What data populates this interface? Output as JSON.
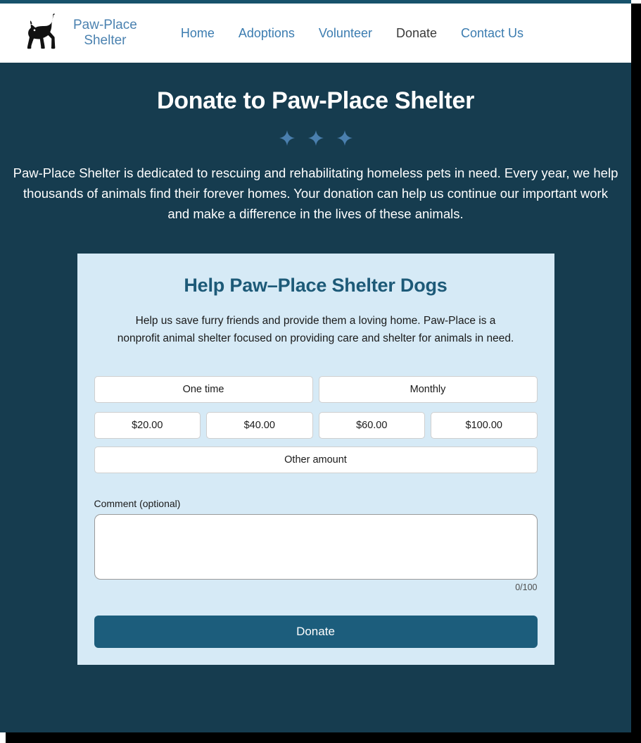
{
  "theme": {
    "page_bg": "#163c4f",
    "navbar_bg": "#ffffff",
    "brand_color": "#4b82b0",
    "nav_link_color": "#3b7cb0",
    "nav_link_active_color": "#3a3a3a",
    "card_bg": "#d6eaf6",
    "card_title_color": "#1d5a78",
    "donate_button_bg": "#1c5d7c",
    "sparkle_color": "#4a7fae",
    "option_button_bg": "#ffffff"
  },
  "navbar": {
    "logo_icon": "cat-silhouette-icon",
    "brand_name": "Paw-Place\nShelter",
    "links": [
      {
        "label": "Home",
        "active": false
      },
      {
        "label": "Adoptions",
        "active": false
      },
      {
        "label": "Volunteer",
        "active": false
      },
      {
        "label": "Donate",
        "active": true
      },
      {
        "label": "Contact Us",
        "active": false
      }
    ]
  },
  "hero": {
    "title": "Donate to Paw-Place Shelter",
    "decoration_icon": "sparkle-icon",
    "decoration_count": 3,
    "body": "Paw-Place Shelter is dedicated to rescuing and rehabilitating homeless pets in need. Every year, we help thousands of animals find their forever homes. Your donation can help us continue our important work and make a difference in the lives of these animals."
  },
  "donation_card": {
    "title": "Help Paw–Place Shelter Dogs",
    "description": "Help us save furry friends and provide them a loving home. Paw-Place is a nonprofit animal shelter focused on providing care and shelter for animals in need.",
    "frequency_options": [
      {
        "label": "One time"
      },
      {
        "label": "Monthly"
      }
    ],
    "amount_options": [
      {
        "label": "$20.00"
      },
      {
        "label": "$40.00"
      },
      {
        "label": "$60.00"
      },
      {
        "label": "$100.00"
      }
    ],
    "other_amount": {
      "label": "Other amount"
    },
    "comment": {
      "label": "Comment (optional)",
      "value": "",
      "placeholder": "",
      "char_count": "0/100",
      "max_length": 100
    },
    "submit": {
      "label": "Donate"
    }
  }
}
